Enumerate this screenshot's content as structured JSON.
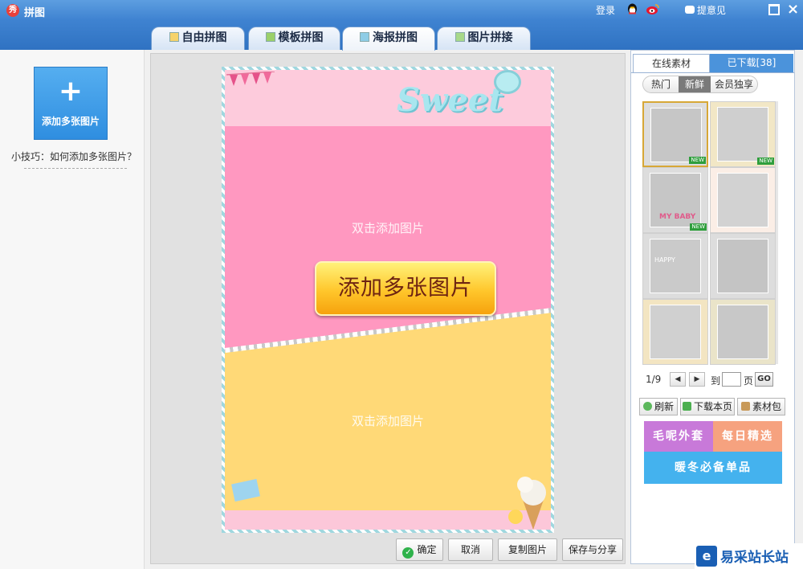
{
  "window": {
    "title": "拼图",
    "logo_char": "秀",
    "login": "登录",
    "feedback": "提意见"
  },
  "tabs": [
    {
      "label": "自由拼图",
      "active": false
    },
    {
      "label": "模板拼图",
      "active": false
    },
    {
      "label": "海报拼图",
      "active": true
    },
    {
      "label": "图片拼接",
      "active": false
    }
  ],
  "left_panel": {
    "add_button": "添加多张图片",
    "tip": "小技巧：如何添加多张图片？"
  },
  "canvas": {
    "placeholder_top": "双击添加图片",
    "placeholder_bottom": "双击添加图片",
    "center_button": "添加多张图片",
    "decor_word": "Sweet"
  },
  "bottom_buttons": {
    "confirm": "确定",
    "cancel": "取消",
    "copy": "复制图片",
    "save_share": "保存与分享"
  },
  "right_panel": {
    "tabs": [
      {
        "label": "在线素材",
        "active": true
      },
      {
        "label": "已下载[38]",
        "active": false
      }
    ],
    "filters": [
      {
        "label": "热门",
        "selected": false
      },
      {
        "label": "新鲜",
        "selected": true
      },
      {
        "label": "会员独享",
        "selected": false
      }
    ],
    "thumbnails": [
      {
        "badge": "NEW",
        "selected": true
      },
      {
        "badge": "NEW",
        "selected": false
      },
      {
        "badge": "NEW",
        "selected": false,
        "caption": "MY BABY"
      },
      {
        "badge": "",
        "selected": false
      },
      {
        "badge": "",
        "selected": false,
        "caption": "HAPPY"
      },
      {
        "badge": "",
        "selected": false
      },
      {
        "badge": "",
        "selected": false
      },
      {
        "badge": "",
        "selected": false
      }
    ],
    "pager": {
      "page": "1/9",
      "to": "到",
      "page_unit": "页",
      "go": "GO"
    },
    "actions": {
      "refresh": "刷新",
      "download_page": "下载本页",
      "pack": "素材包"
    },
    "banners": {
      "b1": "毛呢外套",
      "b2": "每日精选",
      "b3": "暖冬必备单品"
    }
  },
  "watermark": {
    "text": "易采站长站"
  },
  "colors": {
    "titlebar": "#3f83d1",
    "accent_blue": "#4b93db",
    "pink": "#ff98c0",
    "yellow": "#ffd977",
    "button_gold": "#ffc62b"
  }
}
